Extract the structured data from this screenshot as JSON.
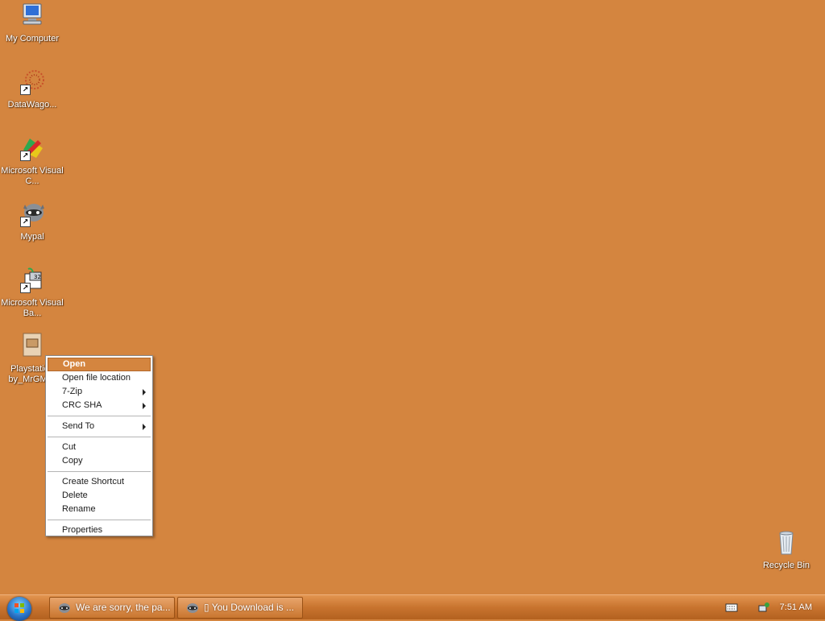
{
  "desktop": {
    "icons": [
      {
        "label": "My Computer"
      },
      {
        "label": "DataWago..."
      },
      {
        "label": "Microsoft Visual C..."
      },
      {
        "label": "Mypal"
      },
      {
        "label": "Microsoft Visual Ba..."
      },
      {
        "label": "Playstation by_MrGMi z"
      },
      {
        "label": "Recycle Bin"
      }
    ]
  },
  "context_menu": {
    "items": [
      {
        "label": "Open"
      },
      {
        "label": "Open file location"
      },
      {
        "label": "7-Zip"
      },
      {
        "label": "CRC SHA"
      },
      {
        "label": "Send To"
      },
      {
        "label": "Cut"
      },
      {
        "label": "Copy"
      },
      {
        "label": "Create Shortcut"
      },
      {
        "label": "Delete"
      },
      {
        "label": "Rename"
      },
      {
        "label": "Properties"
      }
    ]
  },
  "taskbar": {
    "buttons": [
      {
        "label": "We are sorry, the pa..."
      },
      {
        "label": "▯ You Download is ..."
      }
    ],
    "clock": "7:51 AM"
  },
  "colors": {
    "desktop": "#d4853f",
    "highlight": "#d4853f"
  },
  "icons": [
    "my-computer-icon",
    "datawagon-icon",
    "visual-c-icon",
    "mypal-icon",
    "visual-basic-icon",
    "playstation-file-icon",
    "recycle-bin-icon",
    "keyboard-icon",
    "network-icon",
    "windows-start-icon"
  ]
}
